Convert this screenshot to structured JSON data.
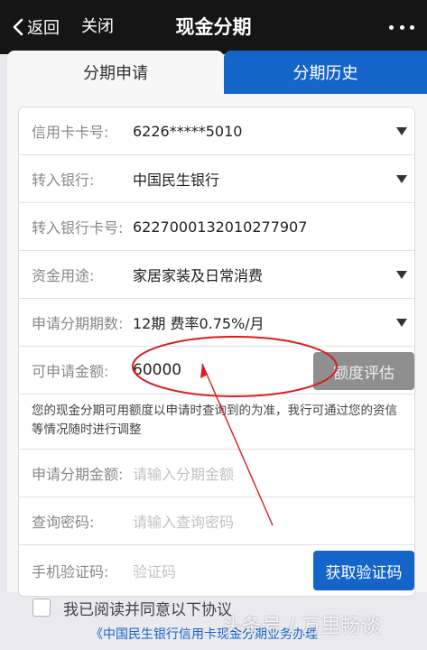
{
  "nav": {
    "back_label": "返回",
    "close_label": "关闭",
    "title": "现金分期"
  },
  "tabs": [
    {
      "label": "分期申请",
      "active": true
    },
    {
      "label": "分期历史",
      "active": false
    }
  ],
  "form": {
    "card_number": {
      "label": "信用卡卡号:",
      "value": "6226*****5010"
    },
    "bank": {
      "label": "转入银行:",
      "value": "中国民生银行"
    },
    "bank_card": {
      "label": "转入银行卡号:",
      "value": "6227000132010277907"
    },
    "purpose": {
      "label": "资金用途:",
      "value": "家居家装及日常消费"
    },
    "periods": {
      "label": "申请分期期数:",
      "value": "12期  费率0.75%/月"
    },
    "available": {
      "label": "可申请金额:",
      "value": "60000",
      "button": "额度评估"
    },
    "note": "您的现金分期可用额度以申请时查询到的为准，我行可通过您的资信等情况随时进行调整",
    "amount": {
      "label": "申请分期金额:",
      "placeholder": "请输入分期金额"
    },
    "password": {
      "label": "查询密码:",
      "placeholder": "请输入查询密码"
    },
    "sms": {
      "label": "手机验证码:",
      "placeholder": "验证码",
      "button": "获取验证码"
    }
  },
  "agreement": {
    "text": "我已阅读并同意以下协议",
    "link": "《中国民生银行信用卡现金分期业务办理"
  },
  "watermark": "头条号 / 万里畅谈",
  "colors": {
    "brand_blue": "#1565c8",
    "nav_bg": "#151515",
    "annotation_red": "#d81e1e"
  }
}
